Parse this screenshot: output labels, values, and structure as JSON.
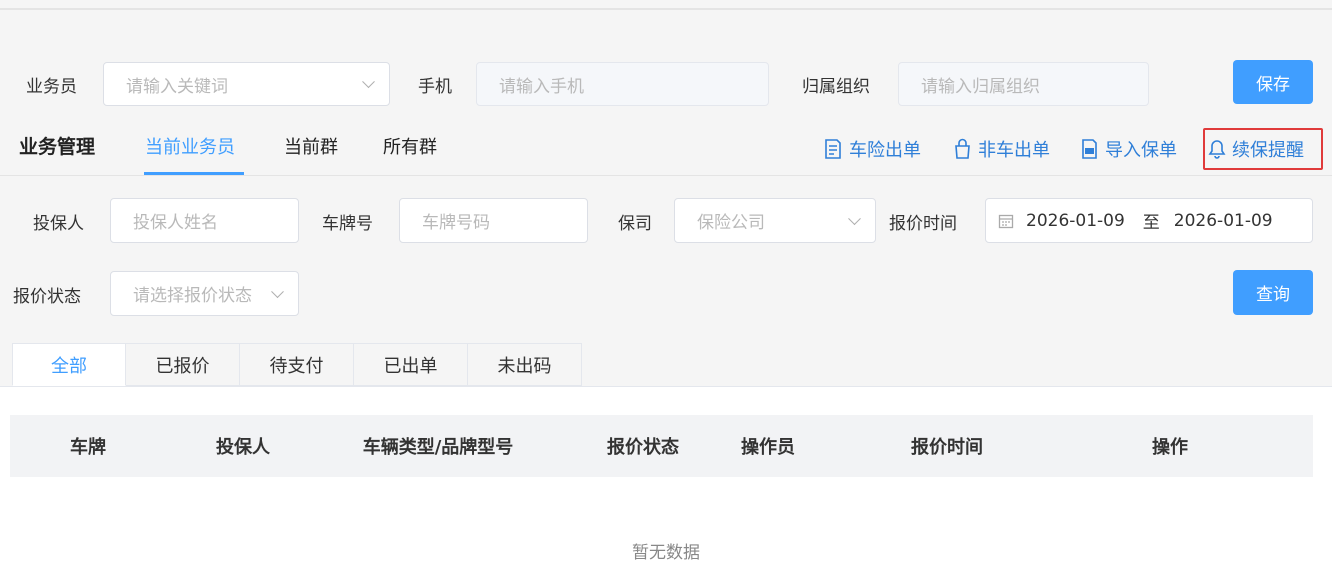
{
  "filters": {
    "salesman_label": "业务员",
    "salesman_placeholder": "请输入关键词",
    "phone_label": "手机",
    "phone_placeholder": "请输入手机",
    "org_label": "归属组织",
    "org_placeholder": "请输入归属组织",
    "save_label": "保存"
  },
  "business": {
    "title": "业务管理",
    "subtabs": [
      "当前业务员",
      "当前群",
      "所有群"
    ],
    "actions": [
      {
        "label": "车险出单",
        "icon": "document-icon"
      },
      {
        "label": "非车出单",
        "icon": "bag-icon"
      },
      {
        "label": "导入保单",
        "icon": "pdf-file-icon"
      },
      {
        "label": "续保提醒",
        "icon": "bell-icon"
      }
    ],
    "highlight_color": "#e03a3a"
  },
  "search": {
    "insured_label": "投保人",
    "insured_placeholder": "投保人姓名",
    "plate_label": "车牌号",
    "plate_placeholder": "车牌号码",
    "insurer_label": "保司",
    "insurer_placeholder": "保险公司",
    "quote_time_label": "报价时间",
    "date_start": "2026-01-09",
    "date_separator": "至",
    "date_end": "2026-01-09",
    "status_label": "报价状态",
    "status_placeholder": "请选择报价状态",
    "query_label": "查询"
  },
  "tabs": [
    "全部",
    "已报价",
    "待支付",
    "已出单",
    "未出码"
  ],
  "table": {
    "headers": [
      "车牌",
      "投保人",
      "车辆类型/品牌型号",
      "报价状态",
      "操作员",
      "报价时间",
      "操作"
    ],
    "empty_text": "暂无数据"
  },
  "colors": {
    "primary": "#409eff",
    "link": "#2f7fd8"
  }
}
